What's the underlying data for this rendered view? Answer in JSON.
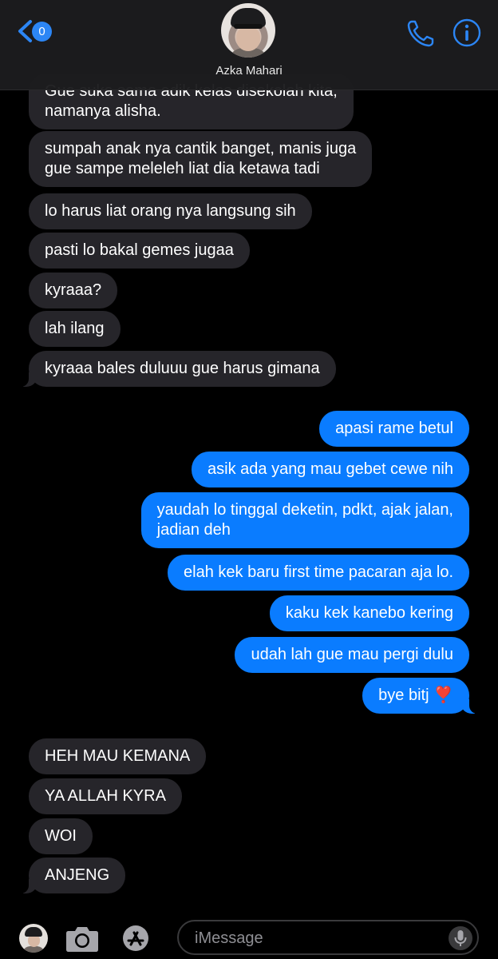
{
  "header": {
    "back_badge": "0",
    "contact_name": "Azka Mahari",
    "icons": [
      "chevron-left-icon",
      "phone-icon",
      "info-icon"
    ],
    "accent_color": "#2c86f5"
  },
  "messages": [
    {
      "from": "contact",
      "lines": [
        "Gue suka sama adik kelas disekolah kita,",
        "namanya alisha."
      ]
    },
    {
      "from": "contact",
      "lines": [
        "sumpah anak nya cantik banget, manis juga",
        "gue sampe meleleh liat dia ketawa tadi"
      ]
    },
    {
      "from": "contact",
      "lines": [
        "lo harus liat orang nya langsung sih"
      ]
    },
    {
      "from": "contact",
      "lines": [
        "pasti lo bakal gemes jugaa"
      ]
    },
    {
      "from": "contact",
      "lines": [
        "kyraaa?"
      ]
    },
    {
      "from": "contact",
      "lines": [
        "lah ilang"
      ]
    },
    {
      "from": "contact",
      "lines": [
        "kyraaa bales duluuu gue harus gimana"
      ]
    },
    {
      "from": "me",
      "lines": [
        "apasi rame betul"
      ]
    },
    {
      "from": "me",
      "lines": [
        "asik ada yang mau gebet cewe nih"
      ]
    },
    {
      "from": "me",
      "lines": [
        "yaudah lo tinggal deketin, pdkt, ajak jalan,",
        "jadian deh"
      ]
    },
    {
      "from": "me",
      "lines": [
        "elah kek baru first time pacaran aja lo."
      ]
    },
    {
      "from": "me",
      "lines": [
        "kaku kek kanebo kering"
      ]
    },
    {
      "from": "me",
      "lines": [
        "udah lah gue mau pergi dulu"
      ]
    },
    {
      "from": "me",
      "lines": [
        "bye bitj ❣️"
      ]
    },
    {
      "from": "contact",
      "lines": [
        "HEH MAU KEMANA"
      ]
    },
    {
      "from": "contact",
      "lines": [
        "YA ALLAH KYRA"
      ]
    },
    {
      "from": "contact",
      "lines": [
        "WOI"
      ]
    },
    {
      "from": "contact",
      "lines": [
        "ANJENG"
      ]
    }
  ],
  "input_bar": {
    "placeholder": "iMessage",
    "icons": [
      "avatar",
      "camera-icon",
      "app-store-icon",
      "microphone-icon"
    ]
  },
  "colors": {
    "incoming_bubble": "#26252a",
    "outgoing_bubble": "#0a7cff",
    "background": "#000000"
  }
}
